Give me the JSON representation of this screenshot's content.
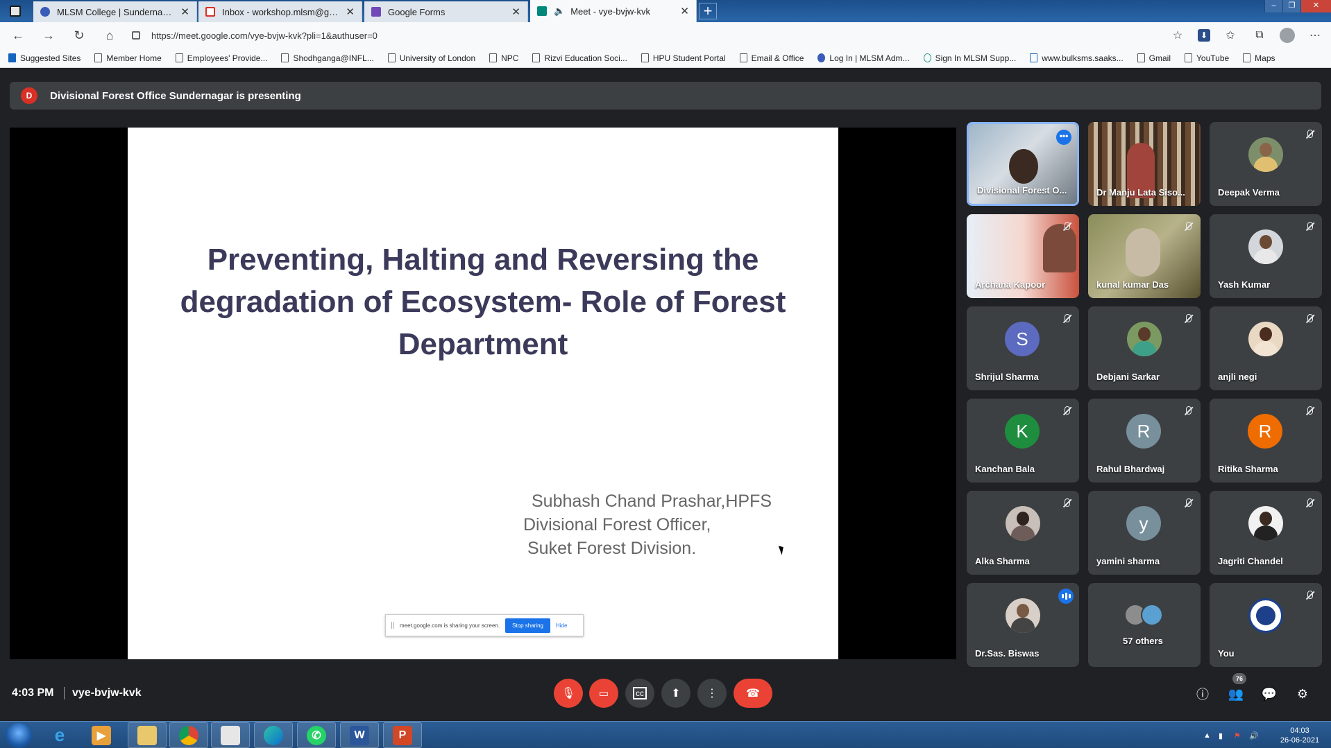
{
  "browser": {
    "tabs": [
      {
        "label": "MLSM College | Sundernagar, Mandi",
        "favicon_color": "#3b5bb8"
      },
      {
        "label": "Inbox - workshop.mlsm@gmail.com",
        "favicon_color": "#d93025"
      },
      {
        "label": "Google Forms",
        "favicon_color": "#7248b9"
      },
      {
        "label": "Meet - vye-bvjw-kvk",
        "favicon_color": "#00897b"
      }
    ],
    "url": "https://meet.google.com/vye-bvjw-kvk?pli=1&authuser=0",
    "bookmarks": [
      "Suggested Sites",
      "Member Home",
      "Employees' Provide...",
      "Shodhganga@INFL...",
      "University of London",
      "NPC",
      "Rizvi Education Soci...",
      "HPU Student Portal",
      "Email & Office",
      "Log In | MLSM Adm...",
      "Sign In MLSM Supp...",
      "www.bulksms.saaks...",
      "Gmail",
      "YouTube",
      "Maps"
    ]
  },
  "meet": {
    "presenter_initial": "D",
    "presenting_text": "Divisional Forest Office Sundernagar is presenting",
    "slide": {
      "title": "Preventing, Halting and Reversing the degradation of Ecosystem- Role of Forest Department",
      "author_line1": "Subhash Chand Prashar,HPFS",
      "author_line2": "Divisional Forest Officer,",
      "author_line3": "Suket Forest Division."
    },
    "sharebar": {
      "text": "meet.google.com is sharing your screen.",
      "stop_label": "Stop sharing",
      "hide_label": "Hide"
    },
    "participants": [
      {
        "name": "Divisional Forest O...",
        "kind": "video"
      },
      {
        "name": "Dr Manju Lata Siso...",
        "kind": "video"
      },
      {
        "name": "Deepak Verma",
        "kind": "photo"
      },
      {
        "name": "Archana Kapoor",
        "kind": "video"
      },
      {
        "name": "kunal kumar Das",
        "kind": "video"
      },
      {
        "name": "Yash Kumar",
        "kind": "photo"
      },
      {
        "name": "Shrijul Sharma",
        "kind": "letter",
        "letter": "S",
        "color": "#5c6bc0"
      },
      {
        "name": "Debjani Sarkar",
        "kind": "photo"
      },
      {
        "name": "anjli negi",
        "kind": "photo"
      },
      {
        "name": "Kanchan Bala",
        "kind": "letter",
        "letter": "K",
        "color": "#1e8e3e"
      },
      {
        "name": "Rahul Bhardwaj",
        "kind": "letter",
        "letter": "R",
        "color": "#78909c"
      },
      {
        "name": "Ritika Sharma",
        "kind": "letter",
        "letter": "R",
        "color": "#ef6c00"
      },
      {
        "name": "Alka Sharma",
        "kind": "photo"
      },
      {
        "name": "yamini sharma",
        "kind": "letter",
        "letter": "y",
        "color": "#78909c"
      },
      {
        "name": "Jagriti Chandel",
        "kind": "photo"
      },
      {
        "name": "Dr.Sas. Biswas",
        "kind": "photo"
      },
      {
        "name": "57 others",
        "kind": "others"
      },
      {
        "name": "You",
        "kind": "photo"
      }
    ],
    "time": "4:03 PM",
    "meeting_code": "vye-bvjw-kvk",
    "participant_count": "76"
  },
  "taskbar": {
    "clock_time": "04:03",
    "clock_date": "26-06-2021"
  }
}
